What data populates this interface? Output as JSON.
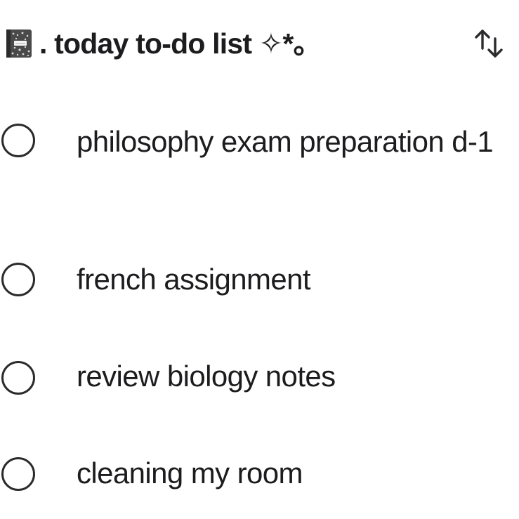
{
  "header": {
    "title": ". today to-do list ✧*。",
    "notebook_icon": "composition-notebook-icon",
    "sort_icon": "sort-arrows-icon"
  },
  "todos": [
    {
      "text": "philosophy exam preparation d-1",
      "checked": false
    },
    {
      "text": "french assignment",
      "checked": false
    },
    {
      "text": "review biology notes",
      "checked": false
    },
    {
      "text": "cleaning my room",
      "checked": false
    }
  ],
  "colors": {
    "text": "#1c1c1e",
    "circle": "#2b2b2d",
    "background": "#ffffff"
  }
}
